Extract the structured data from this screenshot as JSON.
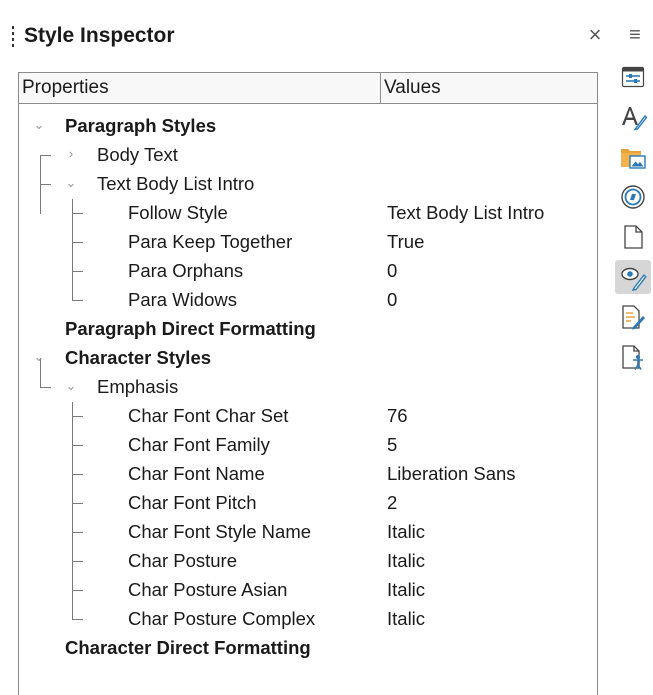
{
  "deck": {
    "title": "Style Inspector",
    "close_glyph": "×",
    "menu_glyph": "≡"
  },
  "columns": {
    "properties": "Properties",
    "values": "Values"
  },
  "tree": {
    "paragraph_styles": "Paragraph Styles",
    "body_text": "Body Text",
    "text_body_list_intro": "Text Body List Intro",
    "para_props": [
      {
        "name": "Follow Style",
        "value": "Text Body List Intro"
      },
      {
        "name": "Para Keep Together",
        "value": "True"
      },
      {
        "name": "Para Orphans",
        "value": "0"
      },
      {
        "name": "Para Widows",
        "value": "0"
      }
    ],
    "paragraph_direct_formatting": "Paragraph Direct Formatting",
    "character_styles": "Character Styles",
    "emphasis": "Emphasis",
    "char_props": [
      {
        "name": "Char Font Char Set",
        "value": "76"
      },
      {
        "name": "Char Font Family",
        "value": "5"
      },
      {
        "name": "Char Font Name",
        "value": "Liberation Sans"
      },
      {
        "name": "Char Font Pitch",
        "value": "2"
      },
      {
        "name": "Char Font Style Name",
        "value": "Italic"
      },
      {
        "name": "Char Posture",
        "value": "Italic"
      },
      {
        "name": "Char Posture Asian",
        "value": "Italic"
      },
      {
        "name": "Char Posture Complex",
        "value": "Italic"
      }
    ],
    "character_direct_formatting": "Character Direct Formatting"
  },
  "sidebar_tabs": [
    {
      "icon": "properties-icon"
    },
    {
      "icon": "styles-icon"
    },
    {
      "icon": "gallery-icon"
    },
    {
      "icon": "navigator-icon"
    },
    {
      "icon": "page-icon"
    },
    {
      "icon": "style-inspector-icon",
      "active": true
    },
    {
      "icon": "manage-changes-icon"
    },
    {
      "icon": "accessibility-check-icon"
    }
  ],
  "colors": {
    "accent_blue": "#2a7ab8",
    "folder_orange": "#e8a23a",
    "active_tab_bg": "#d6d6d6"
  }
}
